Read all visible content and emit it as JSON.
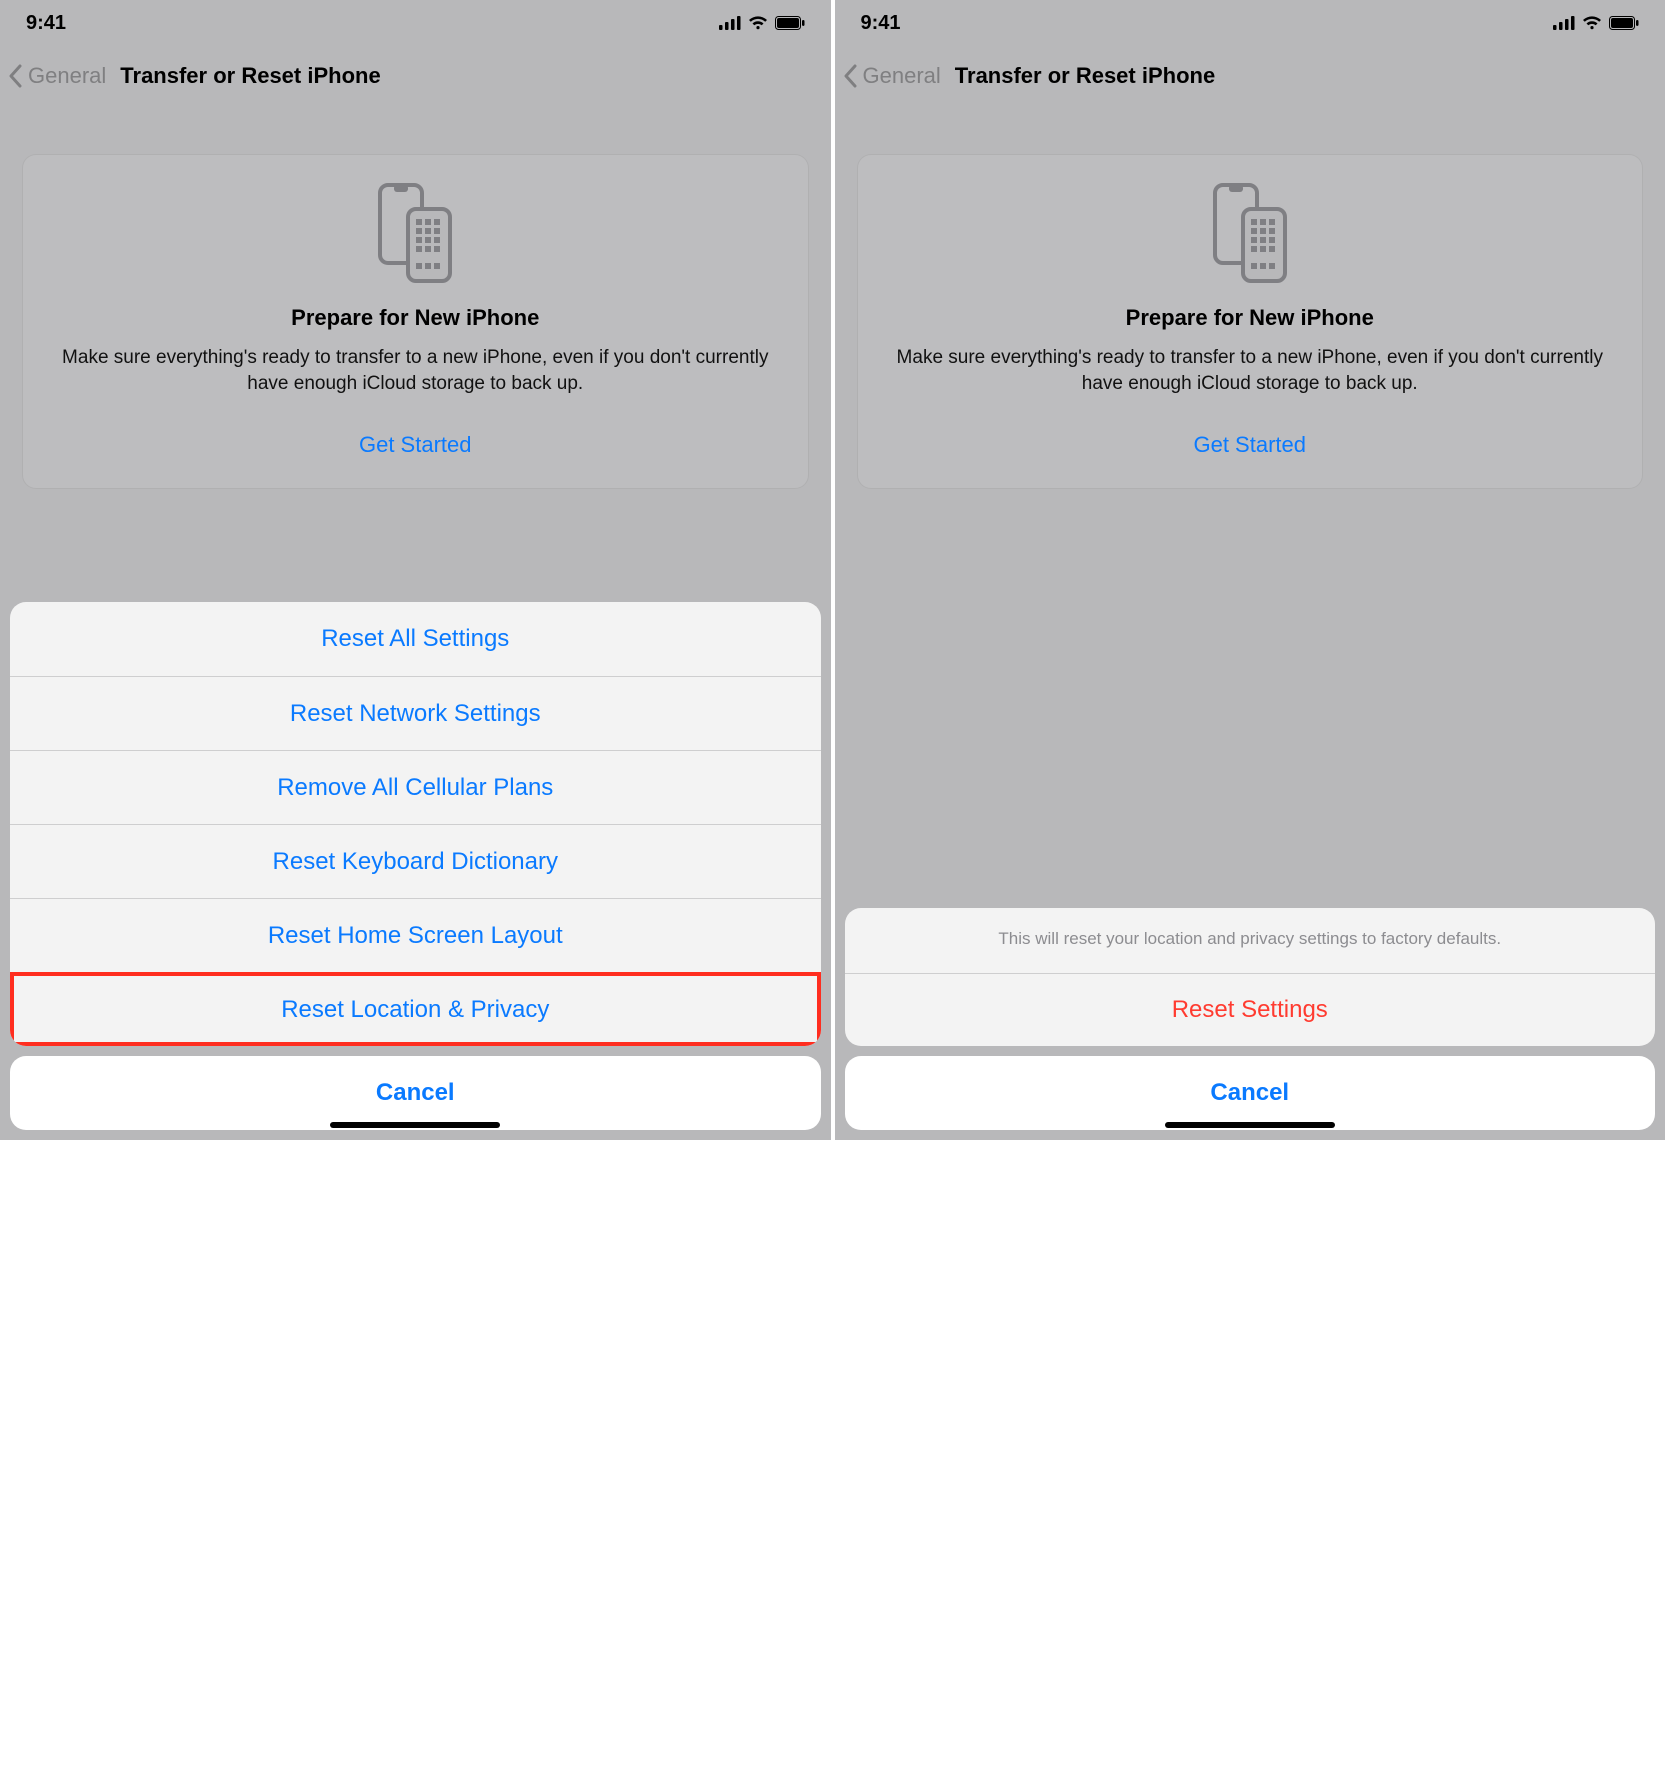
{
  "status": {
    "time": "9:41"
  },
  "nav": {
    "back_label": "General",
    "title": "Transfer or Reset iPhone"
  },
  "card": {
    "title": "Prepare for New iPhone",
    "desc": "Make sure everything's ready to transfer to a new iPhone, even if you don't currently have enough iCloud storage to back up.",
    "cta": "Get Started"
  },
  "sheet_left": {
    "items": [
      "Reset All Settings",
      "Reset Network Settings",
      "Remove All Cellular Plans",
      "Reset Keyboard Dictionary",
      "Reset Home Screen Layout",
      "Reset Location & Privacy"
    ],
    "cancel": "Cancel"
  },
  "sheet_right": {
    "message": "This will reset your location and privacy settings to factory defaults.",
    "action": "Reset Settings",
    "cancel": "Cancel"
  }
}
